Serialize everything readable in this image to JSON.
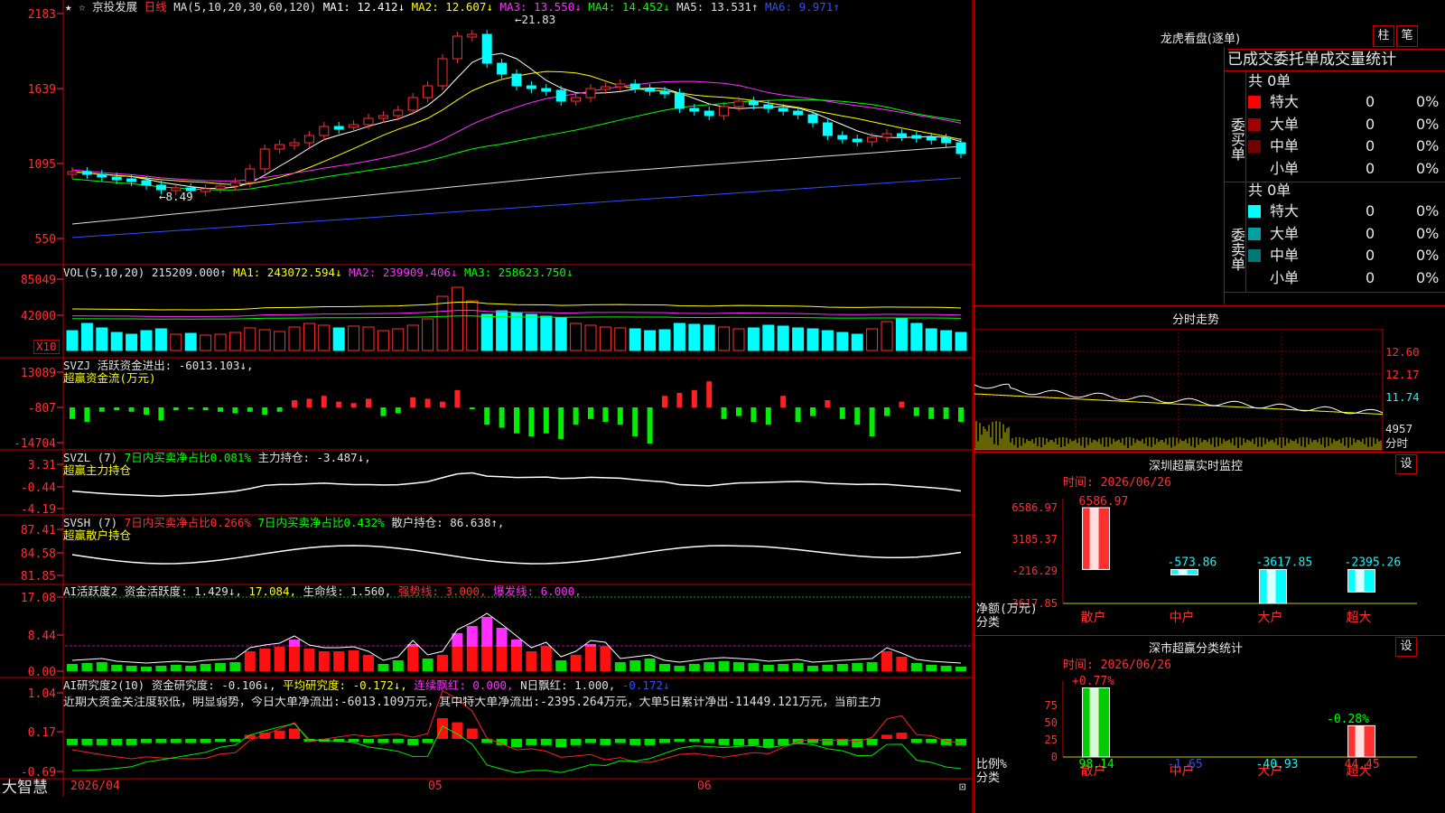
{
  "main_chart": {
    "stock_name": "京投发展",
    "period": "日线",
    "ma_title": "MA(5,10,20,30,60,120)",
    "ma_values": [
      {
        "label": "MA1:",
        "value": "12.412↓",
        "color": "#ffffff"
      },
      {
        "label": "MA2:",
        "value": "12.607↓",
        "color": "#ffff00"
      },
      {
        "label": "MA3:",
        "value": "13.550↓",
        "color": "#ff30ff"
      },
      {
        "label": "MA4:",
        "value": "14.452↓",
        "color": "#00ff00"
      },
      {
        "label": "MA5:",
        "value": "13.531↑",
        "color": "#e0e0e0"
      },
      {
        "label": "MA6:",
        "value": "9.971↑",
        "color": "#3050ff"
      }
    ],
    "y_ticks": [
      "2183",
      "1639",
      "1095",
      "550"
    ],
    "high_label": "21.83",
    "low_label": "8.49"
  },
  "vol_panel": {
    "title": "VOL(5,10,20)",
    "value": "215209.000↑",
    "ma": [
      {
        "label": "MA1:",
        "value": "243072.594↓",
        "color": "#ffff00"
      },
      {
        "label": "MA2:",
        "value": "239909.406↓",
        "color": "#ff30ff"
      },
      {
        "label": "MA3:",
        "value": "258623.750↓",
        "color": "#00ff00"
      }
    ],
    "y_ticks": [
      "85049",
      "42000"
    ],
    "unit": "X10"
  },
  "svzj_panel": {
    "title": "SVZJ",
    "desc": "活跃资金进出: -6013.103↓,",
    "sub": "超赢资金流(万元)",
    "y_ticks": [
      "13089",
      "-807",
      "-14704"
    ]
  },
  "svzl_panel": {
    "title": "SVZL (7)",
    "t1": "7日内买卖净占比0.081%",
    "t2": "主力持仓: -3.487↓,",
    "sub": "超赢主力持仓",
    "y_ticks": [
      "3.31",
      "-0.44",
      "-4.19"
    ]
  },
  "svsh_panel": {
    "title": "SVSH (7)",
    "t1": "7日内买卖净占比0.266%",
    "t2": "7日内买卖净占比0.432%",
    "t3": "散户持仓: 86.638↑,",
    "sub": "超赢散户持仓",
    "y_ticks": [
      "87.41",
      "84.58",
      "81.85"
    ]
  },
  "ai1_panel": {
    "title": "AI活跃度2",
    "t1": "资金活跃度: 1.429↓,",
    "t2": "17.084,",
    "t3": "生命线: 1.560,",
    "t4": "强势线: 3.000,",
    "t5": "爆发线: 6.000,",
    "y_ticks": [
      "17.08",
      "8.44",
      "0.00"
    ]
  },
  "ai2_panel": {
    "title": "AI研究度2(10)",
    "t1": "资金研究度: -0.106↓,",
    "t2": "平均研究度: -0.172↓,",
    "t3": "连续飘红: 0.000,",
    "t4": "N日飘红: 1.000,",
    "t5": "-0.172↓",
    "note": "近期大资金关注度较低，明显弱势，今日大单净流出:-6013.109万元，其中特大单净流出:-2395.264万元，大单5日累计净出-11449.121万元，当前主力",
    "y_ticks": [
      "1.04",
      "0.17",
      "-0.69"
    ]
  },
  "x_axis": {
    "labels": [
      "2026/04",
      "05",
      "06"
    ]
  },
  "brand": "大智慧",
  "order_book": {
    "title": "龙虎看盘(逐单)",
    "tab_bar": "柱",
    "tab_pen": "笔",
    "subtitle": "已成交委托单成交量统计",
    "buy": {
      "side_label": "委买单",
      "total": "共 0单",
      "rows": [
        {
          "name": "特大",
          "count": "0",
          "pct": "0%",
          "color": "#ff0000"
        },
        {
          "name": "大单",
          "count": "0",
          "pct": "0%",
          "color": "#a00000"
        },
        {
          "name": "中单",
          "count": "0",
          "pct": "0%",
          "color": "#700000"
        },
        {
          "name": "小单",
          "count": "0",
          "pct": "0%",
          "color": "#000000"
        }
      ]
    },
    "sell": {
      "side_label": "委卖单",
      "total": "共 0单",
      "rows": [
        {
          "name": "特大",
          "count": "0",
          "pct": "0%",
          "color": "#00ffff"
        },
        {
          "name": "大单",
          "count": "0",
          "pct": "0%",
          "color": "#00a0a0"
        },
        {
          "name": "中单",
          "count": "0",
          "pct": "0%",
          "color": "#007878"
        },
        {
          "name": "小单",
          "count": "0",
          "pct": "0%",
          "color": "#000000"
        }
      ]
    }
  },
  "intraday": {
    "title": "分时走势",
    "prices": [
      "12.60",
      "12.17",
      "11.74"
    ],
    "vol_label": "4957",
    "foot": "分时"
  },
  "sz_monitor": {
    "title": "深圳超赢实时监控",
    "set_label": "设",
    "time_label": "时间: 2026/06/26",
    "y_unit": "净额(万元)",
    "x_caption": "分类",
    "y_ticks": [
      "6586.97",
      "3185.37",
      "-216.29",
      "-3617.85"
    ],
    "top_label": "6586.97"
  },
  "sz_class": {
    "title": "深市超赢分类统计",
    "set_label": "设",
    "time_label": "时间: 2026/06/26",
    "y_unit": "比例%",
    "x_caption": "分类",
    "y_ticks": [
      "75",
      "50",
      "25",
      "0"
    ]
  },
  "chart_data": [
    {
      "type": "bar",
      "title": "深圳超赢实时监控",
      "ylabel": "净额(万元)",
      "categories": [
        "散户",
        "中户",
        "大户",
        "超大"
      ],
      "values": [
        6586.97,
        -573.86,
        -3617.85,
        -2395.26
      ],
      "ylim": [
        -3617.85,
        6586.97
      ]
    },
    {
      "type": "bar",
      "title": "深市超赢分类统计",
      "ylabel": "比例%",
      "categories": [
        "散户",
        "中户",
        "大户",
        "超大"
      ],
      "values": [
        98.14,
        -1.65,
        -40.93,
        44.45
      ],
      "annotations": [
        "+0.77%",
        "-0.28%"
      ]
    }
  ]
}
